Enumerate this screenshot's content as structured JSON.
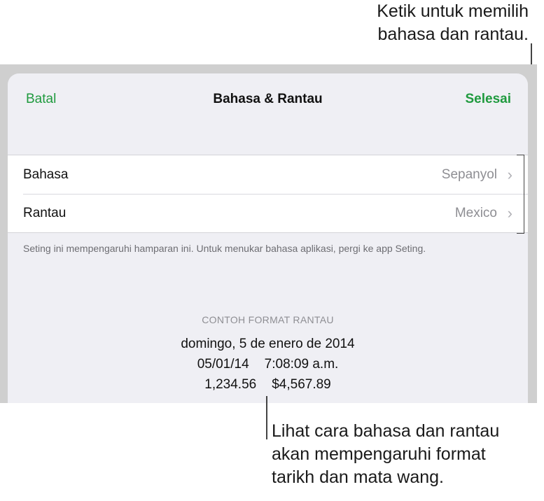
{
  "callouts": {
    "top_line1": "Ketik untuk memilih",
    "top_line2": "bahasa dan rantau.",
    "bottom_line1": "Lihat cara bahasa dan rantau",
    "bottom_line2": "akan mempengaruhi format",
    "bottom_line3": "tarikh dan mata wang."
  },
  "nav": {
    "cancel_label": "Batal",
    "title": "Bahasa & Rantau",
    "done_label": "Selesai"
  },
  "settings": [
    {
      "label": "Bahasa",
      "value": "Sepanyol"
    },
    {
      "label": "Rantau",
      "value": "Mexico"
    }
  ],
  "footnote": "Seting ini mempengaruhi hamparan ini. Untuk menukar bahasa aplikasi, pergi ke app Seting.",
  "sample": {
    "heading": "CONTOH FORMAT RANTAU",
    "date_long": "domingo, 5 de enero de 2014",
    "date_short": "05/01/14",
    "time": "7:08:09 a.m.",
    "number": "1,234.56",
    "currency": "$4,567.89"
  },
  "colors": {
    "accent": "#1f9a3e",
    "background": "#efeff4",
    "secondary_text": "#8e8e93"
  },
  "icons": {
    "disclosure": "chevron-right-icon"
  }
}
